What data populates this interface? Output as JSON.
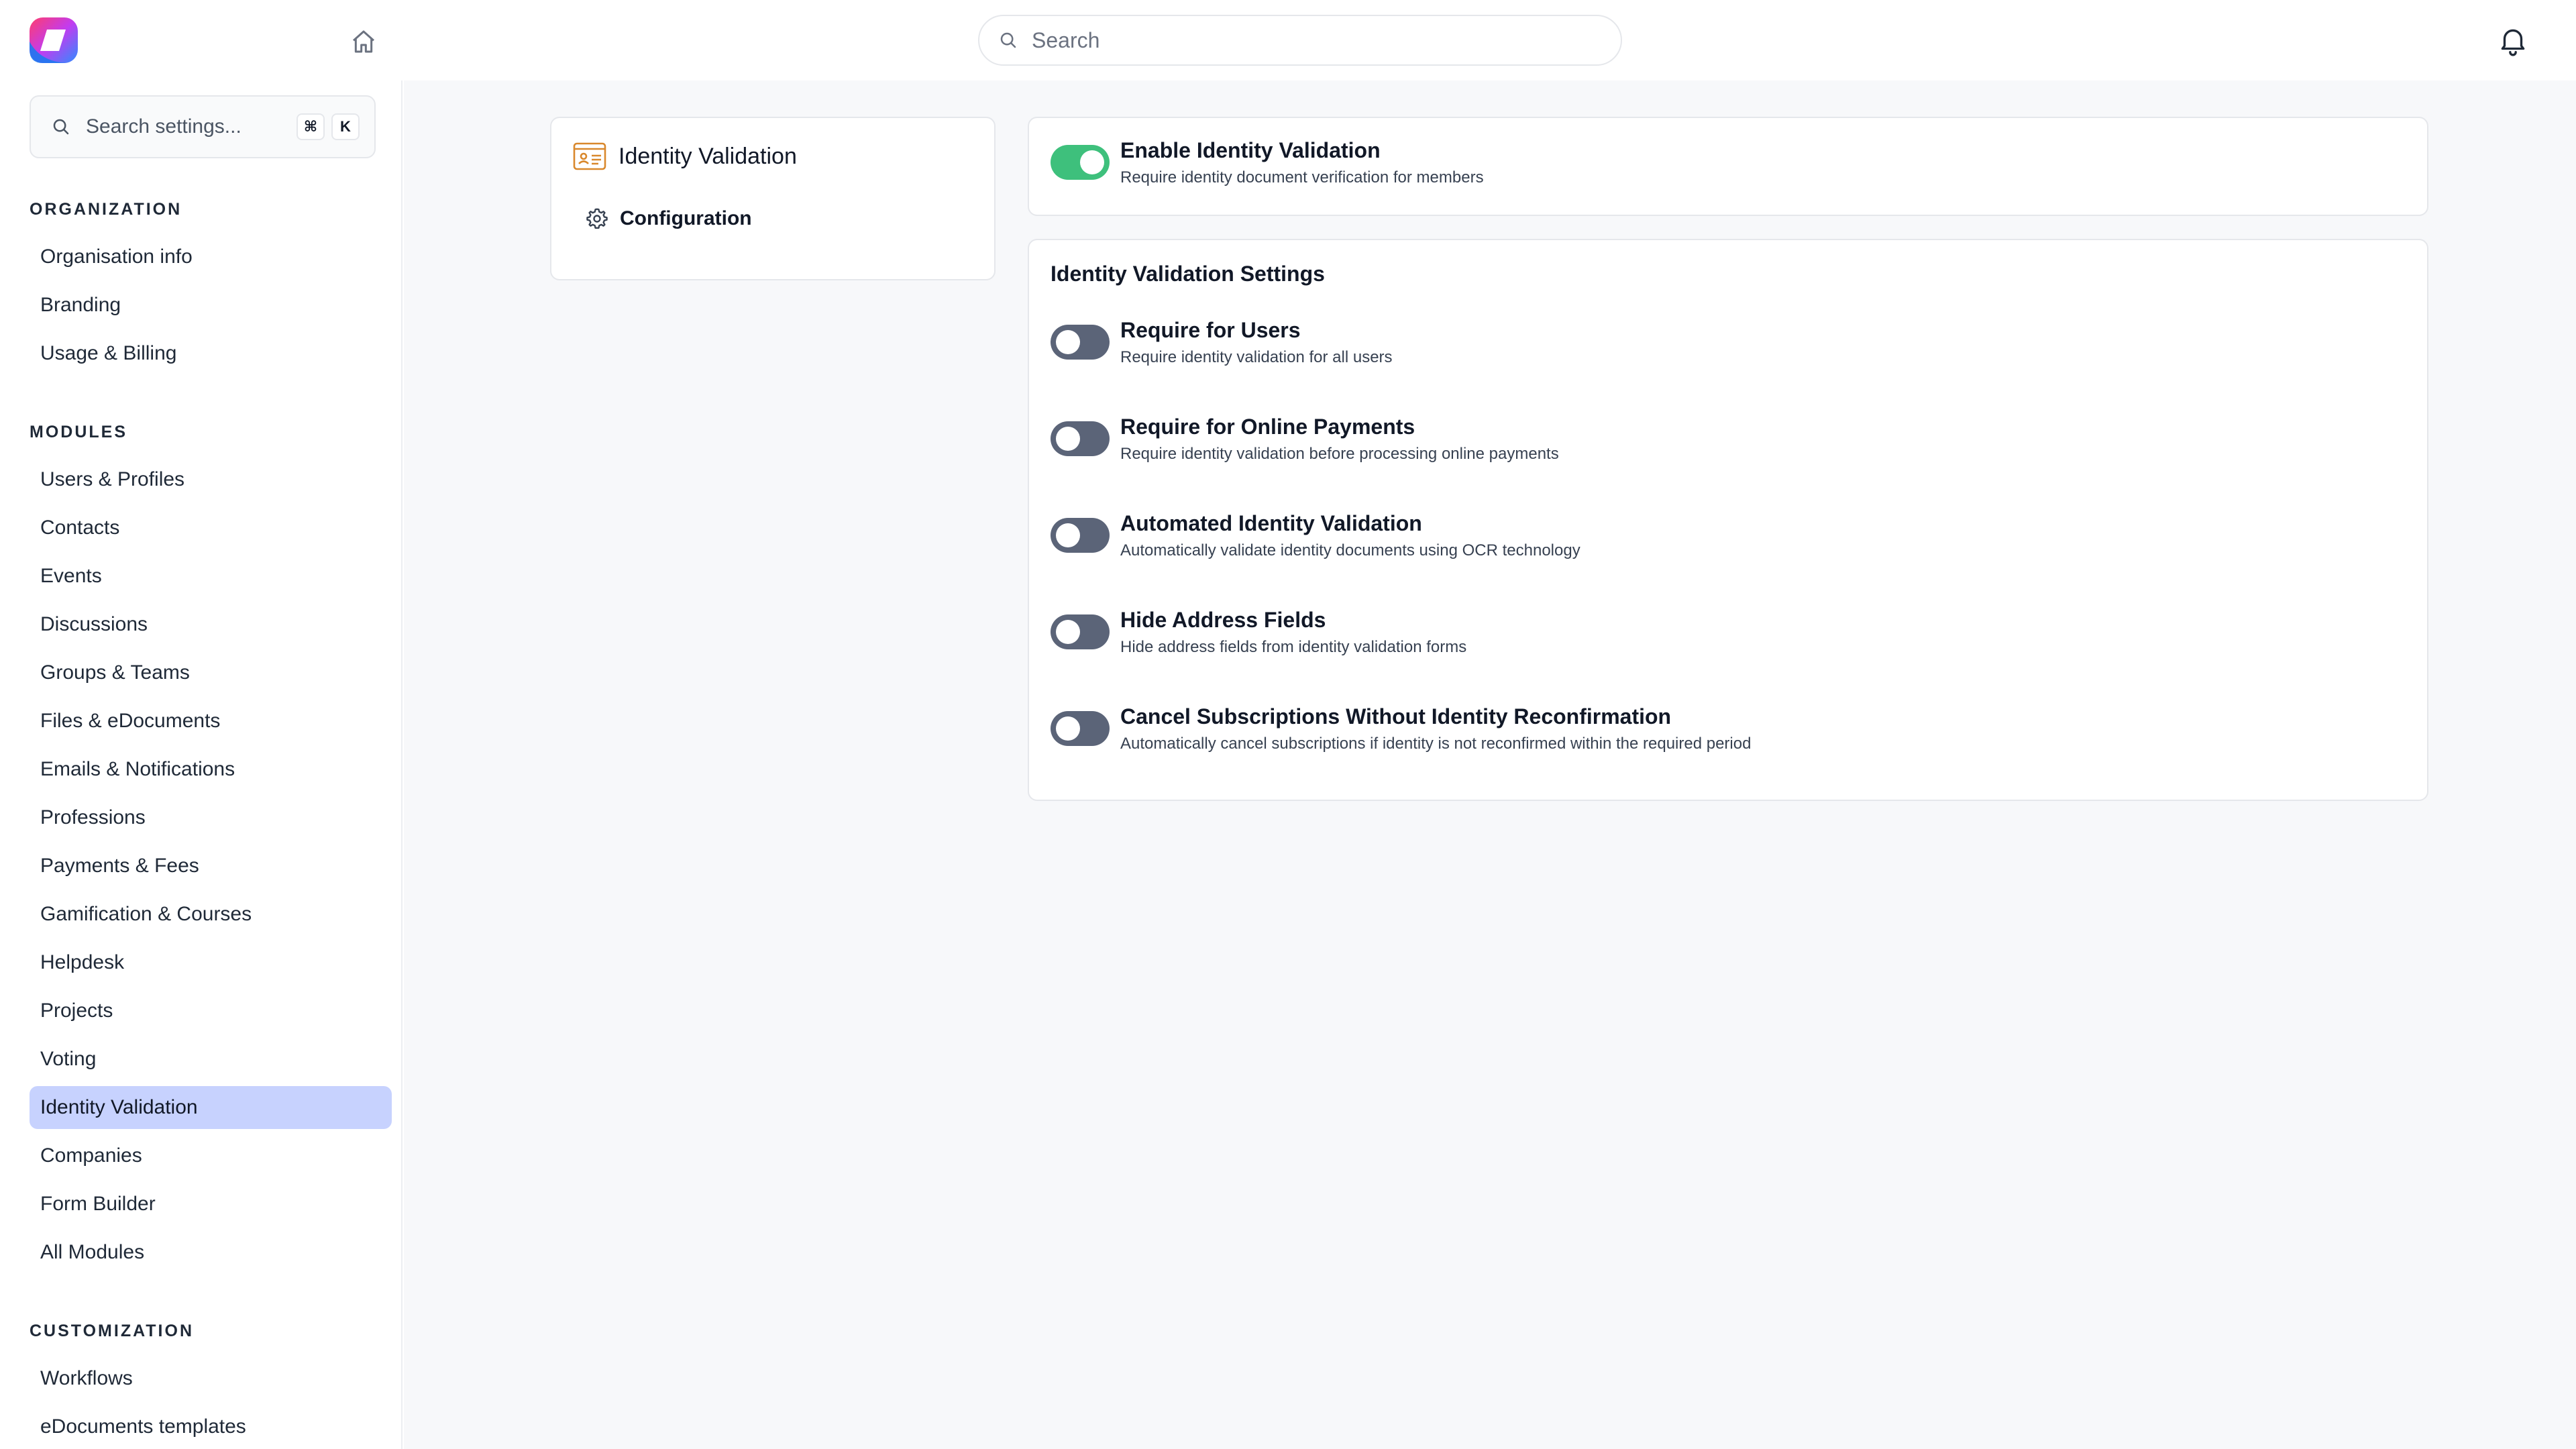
{
  "header": {
    "search_placeholder": "Search"
  },
  "sidebar": {
    "search_placeholder": "Search settings...",
    "shortcut_keys": [
      "⌘",
      "K"
    ],
    "sections": [
      {
        "title": "ORGANIZATION",
        "items": [
          "Organisation info",
          "Branding",
          "Usage & Billing"
        ]
      },
      {
        "title": "MODULES",
        "items": [
          "Users & Profiles",
          "Contacts",
          "Events",
          "Discussions",
          "Groups & Teams",
          "Files & eDocuments",
          "Emails & Notifications",
          "Professions",
          "Payments & Fees",
          "Gamification & Courses",
          "Helpdesk",
          "Projects",
          "Voting",
          "Identity Validation",
          "Companies",
          "Form Builder",
          "All Modules"
        ]
      },
      {
        "title": "CUSTOMIZATION",
        "items": [
          "Workflows",
          "eDocuments templates"
        ]
      }
    ],
    "active_item": "Identity Validation"
  },
  "module_card": {
    "title": "Identity Validation",
    "nav_item": "Configuration"
  },
  "enable": {
    "title": "Enable Identity Validation",
    "description": "Require identity document verification for members",
    "enabled": true
  },
  "settings": {
    "title": "Identity Validation Settings",
    "rows": [
      {
        "title": "Require for Users",
        "description": "Require identity validation for all users",
        "enabled": false
      },
      {
        "title": "Require for Online Payments",
        "description": "Require identity validation before processing online payments",
        "enabled": false
      },
      {
        "title": "Automated Identity Validation",
        "description": "Automatically validate identity documents using OCR technology",
        "enabled": false
      },
      {
        "title": "Hide Address Fields",
        "description": "Hide address fields from identity validation forms",
        "enabled": false
      },
      {
        "title": "Cancel Subscriptions Without Identity Reconfirmation",
        "description": "Automatically cancel subscriptions if identity is not reconfirmed within the required period",
        "enabled": false
      }
    ]
  },
  "colors": {
    "toggle_on": "#3ec07c",
    "toggle_off": "#5b6478",
    "active_nav": "#c7d2fe",
    "module_icon": "#d9882c"
  }
}
